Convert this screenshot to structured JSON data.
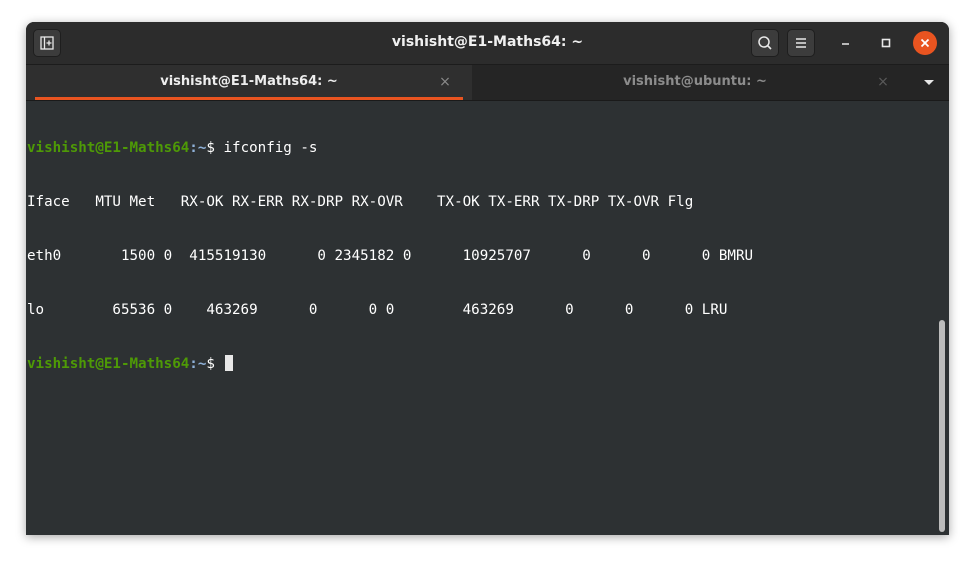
{
  "window": {
    "title": "vishisht@E1-Maths64: ~"
  },
  "tabs": [
    {
      "label": "vishisht@E1-Maths64: ~",
      "active": true
    },
    {
      "label": "vishisht@ubuntu: ~",
      "active": false
    }
  ],
  "icons": {
    "new_tab": "new-tab-icon",
    "search": "search-icon",
    "menu": "hamburger-menu-icon",
    "minimize": "minimize-icon",
    "maximize": "maximize-icon",
    "close": "close-icon",
    "tab_close": "×",
    "tabs_dropdown": "chevron-down-icon"
  },
  "colors": {
    "accent": "#e95420",
    "terminal_bg": "#2d3133",
    "prompt_user": "#4e9a06",
    "prompt_path": "#8fb1d8"
  },
  "terminal": {
    "prompt": {
      "user_host": "vishisht@E1-Maths64",
      "path": ":~",
      "symbol": "$ "
    },
    "command": "ifconfig -s",
    "output": [
      "Iface   MTU Met   RX-OK RX-ERR RX-DRP RX-OVR    TX-OK TX-ERR TX-DRP TX-OVR Flg",
      "eth0       1500 0  415519130      0 2345182 0      10925707      0      0      0 BMRU",
      "lo        65536 0    463269      0      0 0        463269      0      0      0 LRU"
    ]
  }
}
